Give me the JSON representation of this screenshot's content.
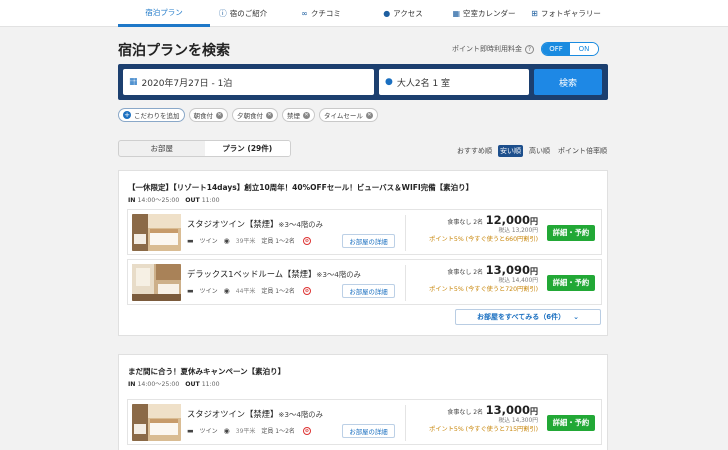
{
  "nav": {
    "tabs": [
      {
        "label": "宿泊プラン",
        "icon": ""
      },
      {
        "label": "宿のご紹介",
        "icon": "info-icon"
      },
      {
        "label": "クチコミ",
        "icon": "chat-bubbles-icon"
      },
      {
        "label": "アクセス",
        "icon": "map-pin-icon"
      },
      {
        "label": "空室カレンダー",
        "icon": "calendar-icon"
      },
      {
        "label": "フォトギャラリー",
        "icon": "grid-icon"
      }
    ],
    "active_index": 0
  },
  "page_title": "宿泊プランを検索",
  "point_toggle": {
    "label": "ポイント即時利用料金",
    "off": "OFF",
    "on": "ON"
  },
  "search": {
    "date": "2020年7月27日 - 1泊",
    "guests": "大人2名 1 室",
    "button": "検索"
  },
  "filters": {
    "add": "こだわりを追加",
    "chips": [
      {
        "label": "朝食付"
      },
      {
        "label": "夕朝食付"
      },
      {
        "label": "禁煙"
      },
      {
        "label": "タイムセール"
      }
    ]
  },
  "view_tabs": [
    "お部屋",
    "プラン (29件)"
  ],
  "sort": [
    "おすすめ順",
    "安い順",
    "高い順",
    "ポイント倍率順"
  ],
  "plans": [
    {
      "title": "【一休限定】【リゾート14days】創立10周年！40%OFFセール！ビューバス＆WIFI完備【素泊り】",
      "in_label": "IN",
      "in_time": "14:00〜25:00",
      "out_label": "OUT",
      "out_time": "11:00",
      "rooms": [
        {
          "name": "スタジオツイン【禁煙】",
          "note": "※3〜4階のみ",
          "bed": "ツイン",
          "size": "39平米",
          "capacity": "定員 1〜2名",
          "detail": "お部屋の詳細",
          "price_label": "食事なし 2名",
          "price": "12,000",
          "yen": "円",
          "tax_in": "税込 13,200円",
          "point": "ポイント5% (今すぐ使うと660円割引)",
          "reserve": "詳細・予約"
        },
        {
          "name": "デラックス1ベッドルーム【禁煙】",
          "note": "※3〜4階のみ",
          "bed": "ツイン",
          "size": "44平米",
          "capacity": "定員 1〜2名",
          "detail": "お部屋の詳細",
          "price_label": "食事なし 2名",
          "price": "13,090",
          "yen": "円",
          "tax_in": "税込 14,400円",
          "point": "ポイント5% (今すぐ使うと720円割引)",
          "reserve": "詳細・予約"
        }
      ],
      "see_all": "お部屋をすべてみる（6件）"
    },
    {
      "title": "まだ間に合う！夏休みキャンペーン【素泊り】",
      "in_label": "IN",
      "in_time": "14:00〜25:00",
      "out_label": "OUT",
      "out_time": "11:00",
      "rooms": [
        {
          "name": "スタジオツイン【禁煙】",
          "note": "※3〜4階のみ",
          "bed": "ツイン",
          "size": "39平米",
          "capacity": "定員 1〜2名",
          "detail": "お部屋の詳細",
          "price_label": "食事なし 2名",
          "price": "13,000",
          "yen": "円",
          "tax_in": "税込 14,300円",
          "point": "ポイント5% (今すぐ使うと715円割引)",
          "reserve": "詳細・予約"
        }
      ]
    }
  ],
  "colors": {
    "brand_blue": "#1e78c8",
    "search_bg": "#1c3f6f",
    "reserve_green": "#22a836",
    "point_orange": "#c8860a"
  }
}
